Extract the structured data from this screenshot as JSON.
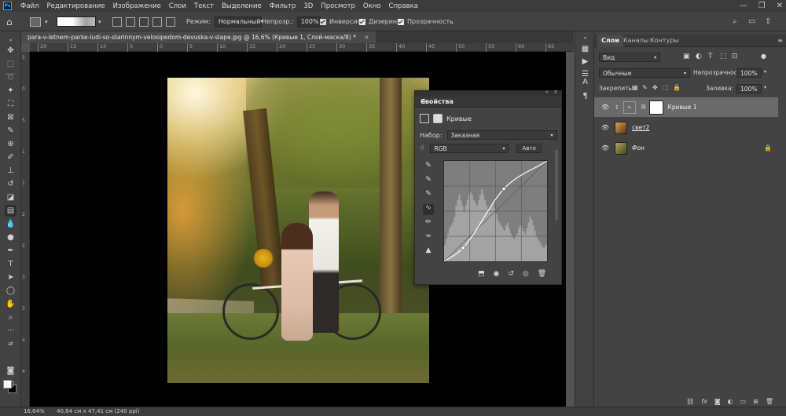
{
  "app": {
    "logo": "Ps"
  },
  "menu": [
    "Файл",
    "Редактирование",
    "Изображение",
    "Слои",
    "Текст",
    "Выделение",
    "Фильтр",
    "3D",
    "Просмотр",
    "Окно",
    "Справка"
  ],
  "window_controls": {
    "minimize": "—",
    "maximize": "❐",
    "close": "✕"
  },
  "options_bar": {
    "mode_label": "Режим:",
    "mode_value": "Нормальный",
    "opacity_label": "Непрозр.:",
    "opacity_value": "100%",
    "inverse_label": "Инверсия",
    "dither_label": "Дизеринг",
    "transparency_label": "Прозрачность",
    "inverse_checked": false,
    "dither_checked": true,
    "transparency_checked": true
  },
  "document": {
    "tab_title": "para-v-letnem-parke-ludi-so-starinnym-velosipedom-devuska-v-slape.jpg @ 16,6% (Кривые 1, Слой-маска/8) *",
    "close_label": "×"
  },
  "ruler_top": [
    "20",
    "15",
    "10",
    "5",
    "0",
    "5",
    "10",
    "15",
    "20",
    "25",
    "30",
    "35",
    "40",
    "45",
    "50",
    "55",
    "60",
    "65"
  ],
  "ruler_left": [
    "5",
    "0",
    "5",
    "1",
    "1",
    "2",
    "2",
    "3",
    "3",
    "4",
    "4"
  ],
  "properties": {
    "title": "Свойства",
    "menu_icon": "≡",
    "collapse": "«",
    "close": "×",
    "adjustment_label": "Кривые",
    "preset_label": "Набор:",
    "preset_value": "Заказная",
    "channel_value": "RGB",
    "auto_label": "Авто"
  },
  "layers_panel": {
    "tabs": [
      "Слои",
      "Каналы",
      "Контуры"
    ],
    "kind_value": "Вид",
    "blend_value": "Обычные",
    "opacity_label": "Непрозрачность:",
    "opacity_value": "100%",
    "lock_label": "Закрепить:",
    "fill_label": "Заливка:",
    "fill_value": "100%",
    "layers": [
      {
        "name": "Кривые 1",
        "selected": true
      },
      {
        "name": "свет2",
        "selected": false
      },
      {
        "name": "Фон",
        "selected": false,
        "locked": true
      }
    ],
    "footer_icons": [
      "link-icon",
      "fx-icon",
      "mask-icon",
      "adjustment-icon",
      "folder-icon",
      "new-layer-icon",
      "trash-icon"
    ]
  },
  "status": {
    "zoom": "16,64%",
    "doc_info": "40,64 см x 47,41 см (240 ppi)"
  },
  "chart_data": {
    "type": "line",
    "title": "",
    "xlabel": "",
    "ylabel": "",
    "xlim": [
      0,
      255
    ],
    "ylim": [
      0,
      255
    ],
    "series": [
      {
        "x": [
          0,
          47,
          148,
          255
        ],
        "y": [
          0,
          34,
          184,
          255
        ]
      }
    ],
    "histogram": [
      6,
      8,
      10,
      12,
      13,
      14,
      16,
      20,
      22,
      24,
      22,
      20,
      18,
      20,
      22,
      24,
      25,
      24,
      22,
      21,
      20,
      22,
      24,
      26,
      24,
      22,
      20,
      18,
      19,
      20,
      21,
      19,
      17,
      15,
      14,
      13,
      12,
      11,
      13,
      14,
      12,
      10,
      9,
      8,
      9,
      10,
      12,
      13,
      12,
      11,
      10,
      12,
      14,
      16,
      15,
      13,
      11,
      9,
      8,
      7,
      6,
      5,
      5,
      6
    ]
  }
}
